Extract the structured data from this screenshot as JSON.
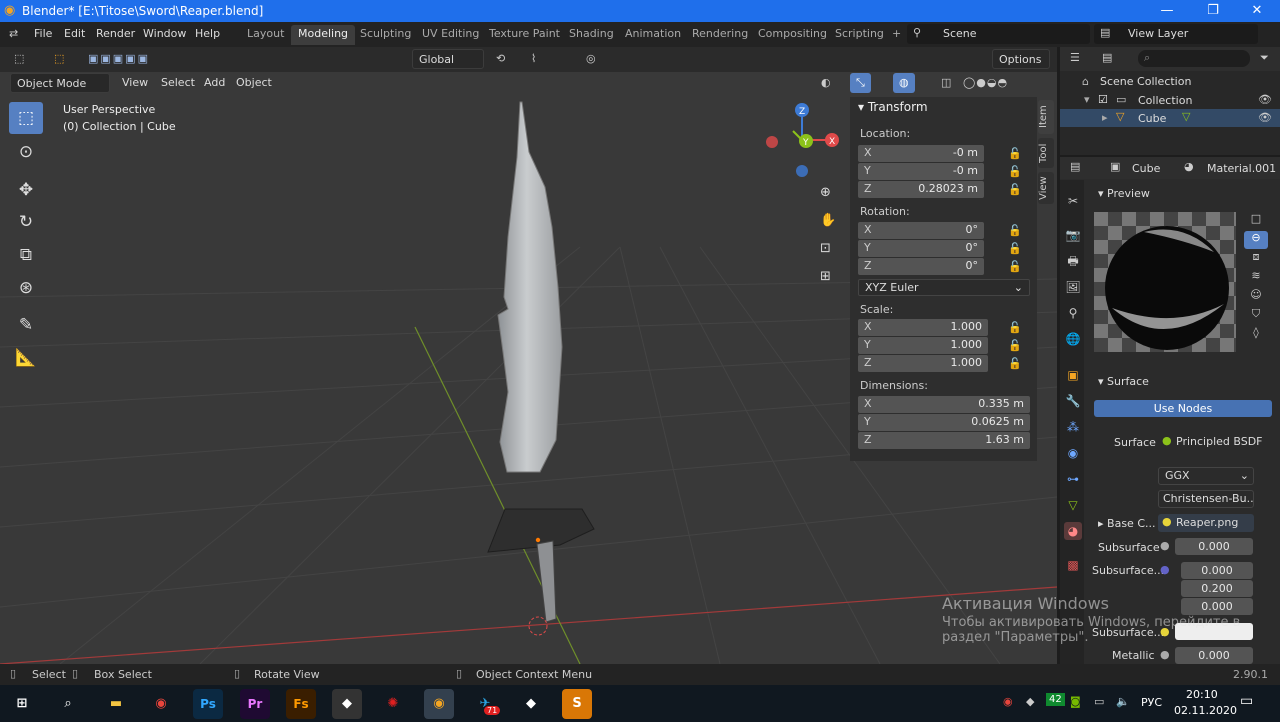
{
  "window": {
    "title": "Blender* [E:\\Titose\\Sword\\Reaper.blend]",
    "min": "—",
    "max": "❐",
    "close": "✕"
  },
  "menu": {
    "editor_icon": "⇄",
    "file": "File",
    "edit": "Edit",
    "render": "Render",
    "window": "Window",
    "help": "Help"
  },
  "workspaces": [
    "Layout",
    "Modeling",
    "Sculpting",
    "UV Editing",
    "Texture Paint",
    "Shading",
    "Animation",
    "Rendering",
    "Compositing",
    "Scripting"
  ],
  "active_workspace": "Modeling",
  "add_workspace": "+",
  "scene": {
    "name": "Scene",
    "view_layer": "View Layer"
  },
  "toolbar": {
    "orientation": "Global",
    "options": "Options"
  },
  "viewport_header": {
    "mode": "Object Mode",
    "view": "View",
    "select": "Select",
    "add": "Add",
    "object": "Object"
  },
  "overlay": {
    "perspective": "User Perspective",
    "collection": "(0) Collection | Cube"
  },
  "gizmo": {
    "x": "X",
    "y": "Y",
    "z": "Z"
  },
  "transform": {
    "title": "Transform",
    "location_label": "Location:",
    "location": [
      {
        "axis": "X",
        "value": "-0 m"
      },
      {
        "axis": "Y",
        "value": "-0 m"
      },
      {
        "axis": "Z",
        "value": "0.28023 m"
      }
    ],
    "rotation_label": "Rotation:",
    "rotation": [
      {
        "axis": "X",
        "value": "0°"
      },
      {
        "axis": "Y",
        "value": "0°"
      },
      {
        "axis": "Z",
        "value": "0°"
      }
    ],
    "rotation_mode": "XYZ Euler",
    "scale_label": "Scale:",
    "scale": [
      {
        "axis": "X",
        "value": "1.000"
      },
      {
        "axis": "Y",
        "value": "1.000"
      },
      {
        "axis": "Z",
        "value": "1.000"
      }
    ],
    "dimensions_label": "Dimensions:",
    "dimensions": [
      {
        "axis": "X",
        "value": "0.335 m"
      },
      {
        "axis": "Y",
        "value": "0.0625 m"
      },
      {
        "axis": "Z",
        "value": "1.63 m"
      }
    ]
  },
  "sidebar_tabs": [
    "Item",
    "Tool",
    "View"
  ],
  "outliner": {
    "scene_collection": "Scene Collection",
    "collection": "Collection",
    "cube": "Cube"
  },
  "properties": {
    "object": "Cube",
    "material": "Material.001",
    "preview": "Preview",
    "surface_panel": "Surface",
    "use_nodes": "Use Nodes",
    "surface_label": "Surface",
    "surface_value": "Principled BSDF",
    "distribution": "GGX",
    "subsurface_method": "Christensen-Bu...",
    "base_color_label": "Base C...",
    "base_color_value": "Reaper.png",
    "subsurface_label": "Subsurface",
    "subsurface_value": "0.000",
    "subsurface_radius_label": "Subsurface...",
    "subsurface_radius": [
      "0.000",
      "0.200",
      "0.000"
    ],
    "subsurface_color_label": "Subsurface...",
    "metallic_label": "Metallic",
    "metallic_value": "0.000"
  },
  "statusbar": {
    "select": "Select",
    "box_select": "Box Select",
    "rotate": "Rotate View",
    "context": "Object Context Menu",
    "version": "2.90.1"
  },
  "watermark": {
    "line1": "Активация Windows",
    "line2": "Чтобы активировать Windows, перейдите в",
    "line3": "раздел \"Параметры\"."
  },
  "taskbar": {
    "apps": [
      "Ps",
      "Pr",
      "Fs"
    ],
    "telegram_badge": "71",
    "lang": "РУС",
    "time": "20:10",
    "date": "02.11.2020",
    "tray_count": "42"
  },
  "colors": {
    "accent": "#5680c2",
    "title": "#1f6feb",
    "x_axis": "#e04a4a",
    "y_axis": "#8cc21a",
    "z_axis": "#3d7bd6"
  }
}
